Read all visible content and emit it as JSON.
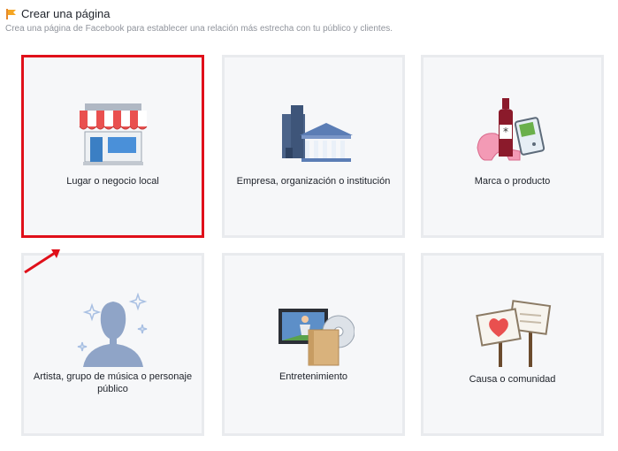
{
  "header": {
    "title": "Crear una página",
    "subtitle": "Crea una página de Facebook para establecer una relación más estrecha con tu público y clientes."
  },
  "categories": [
    {
      "label": "Lugar o negocio local",
      "icon": "storefront-icon",
      "selected": true
    },
    {
      "label": "Empresa, organización o institución",
      "icon": "buildings-icon",
      "selected": false
    },
    {
      "label": "Marca o producto",
      "icon": "products-icon",
      "selected": false
    },
    {
      "label": "Artista, grupo de música o personaje público",
      "icon": "artist-silhouette-icon",
      "selected": false
    },
    {
      "label": "Entretenimiento",
      "icon": "entertainment-icon",
      "selected": false
    },
    {
      "label": "Causa o comunidad",
      "icon": "cause-signs-icon",
      "selected": false
    }
  ],
  "colors": {
    "selected_border": "#e0101a",
    "card_background": "#f6f7f9",
    "card_border": "#e9ebee"
  }
}
